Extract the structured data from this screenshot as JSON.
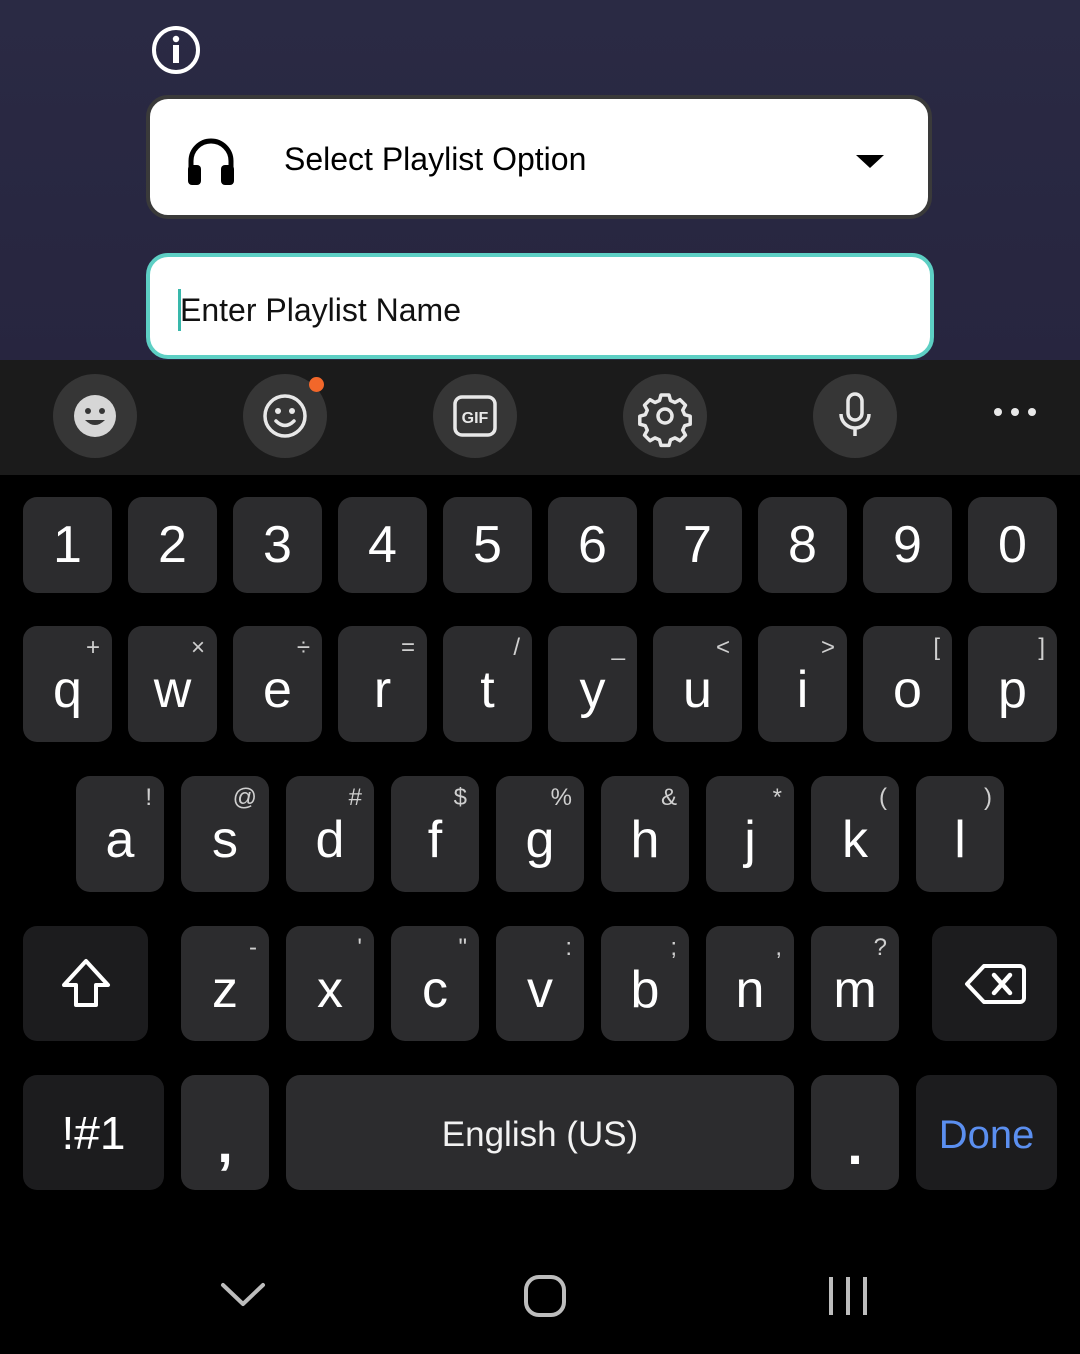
{
  "app": {
    "select_placeholder": "Select Playlist Option",
    "name_placeholder": "Enter Playlist Name",
    "accent_color": "#5dcfc4"
  },
  "keyboard": {
    "toolbar_icons": [
      "emoji-keyboard-icon",
      "emoji-icon",
      "gif-icon",
      "settings-icon",
      "microphone-icon",
      "more-options-icon"
    ],
    "gif_label": "GIF",
    "number_row": [
      "1",
      "2",
      "3",
      "4",
      "5",
      "6",
      "7",
      "8",
      "9",
      "0"
    ],
    "row1": [
      {
        "key": "q",
        "sup": "+"
      },
      {
        "key": "w",
        "sup": "×"
      },
      {
        "key": "e",
        "sup": "÷"
      },
      {
        "key": "r",
        "sup": "="
      },
      {
        "key": "t",
        "sup": "/"
      },
      {
        "key": "y",
        "sup": "_"
      },
      {
        "key": "u",
        "sup": "<"
      },
      {
        "key": "i",
        "sup": ">"
      },
      {
        "key": "o",
        "sup": "["
      },
      {
        "key": "p",
        "sup": "]"
      }
    ],
    "row2": [
      {
        "key": "a",
        "sup": "!"
      },
      {
        "key": "s",
        "sup": "@"
      },
      {
        "key": "d",
        "sup": "#"
      },
      {
        "key": "f",
        "sup": "$"
      },
      {
        "key": "g",
        "sup": "%"
      },
      {
        "key": "h",
        "sup": "&"
      },
      {
        "key": "j",
        "sup": "*"
      },
      {
        "key": "k",
        "sup": "("
      },
      {
        "key": "l",
        "sup": ")"
      }
    ],
    "row3": [
      {
        "key": "z",
        "sup": "-"
      },
      {
        "key": "x",
        "sup": "'"
      },
      {
        "key": "c",
        "sup": "\""
      },
      {
        "key": "v",
        "sup": ":"
      },
      {
        "key": "b",
        "sup": ";"
      },
      {
        "key": "n",
        "sup": ","
      },
      {
        "key": "m",
        "sup": "?"
      }
    ],
    "symbols_label": "!#1",
    "comma_label": ",",
    "space_label": "English (US)",
    "period_label": ".",
    "done_label": "Done",
    "done_color": "#5b8ff0"
  }
}
